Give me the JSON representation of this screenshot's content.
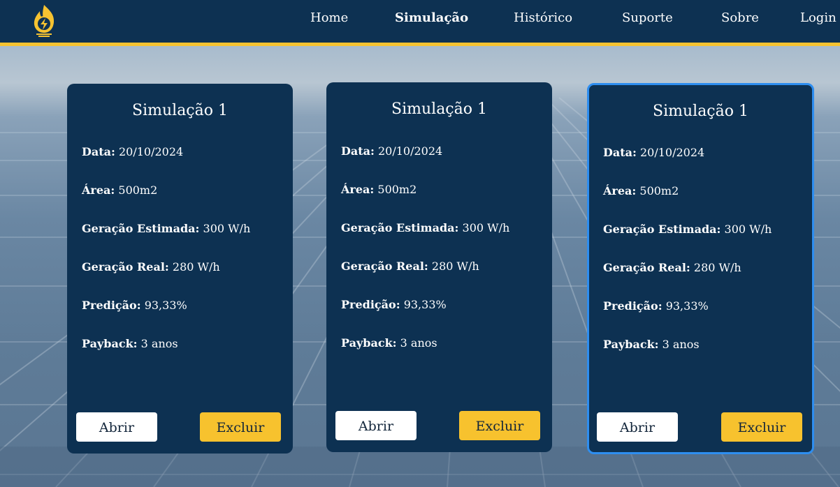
{
  "nav": {
    "items": [
      {
        "label": "Home",
        "active": false
      },
      {
        "label": "Simulação",
        "active": true
      },
      {
        "label": "Histórico",
        "active": false
      },
      {
        "label": "Suporte",
        "active": false
      },
      {
        "label": "Sobre",
        "active": false
      },
      {
        "label": "Login",
        "active": false
      }
    ]
  },
  "cards": [
    {
      "title": "Simulação 1",
      "fields": [
        {
          "label": "Data:",
          "value": "20/10/2024"
        },
        {
          "label": "Área:",
          "value": "500m2"
        },
        {
          "label": "Geração Estimada:",
          "value": "300 W/h"
        },
        {
          "label": "Geração Real:",
          "value": "280 W/h"
        },
        {
          "label": "Predição:",
          "value": "93,33%"
        },
        {
          "label": "Payback:",
          "value": "3 anos"
        }
      ],
      "open_label": "Abrir",
      "delete_label": "Excluir",
      "selected": false
    },
    {
      "title": "Simulação 1",
      "fields": [
        {
          "label": "Data:",
          "value": "20/10/2024"
        },
        {
          "label": "Área:",
          "value": "500m2"
        },
        {
          "label": "Geração Estimada:",
          "value": "300 W/h"
        },
        {
          "label": "Geração Real:",
          "value": "280 W/h"
        },
        {
          "label": "Predição:",
          "value": "93,33%"
        },
        {
          "label": "Payback:",
          "value": "3 anos"
        }
      ],
      "open_label": "Abrir",
      "delete_label": "Excluir",
      "selected": false
    },
    {
      "title": "Simulação 1",
      "fields": [
        {
          "label": "Data:",
          "value": "20/10/2024"
        },
        {
          "label": "Área:",
          "value": "500m2"
        },
        {
          "label": "Geração Estimada:",
          "value": "300 W/h"
        },
        {
          "label": "Geração Real:",
          "value": "280 W/h"
        },
        {
          "label": "Predição:",
          "value": "93,33%"
        },
        {
          "label": "Payback:",
          "value": "3 anos"
        }
      ],
      "open_label": "Abrir",
      "delete_label": "Excluir",
      "selected": true
    }
  ],
  "colors": {
    "navbar": "#0d3152",
    "accent": "#f6c331",
    "card": "#0d3152",
    "selected_border": "#2e8ef0",
    "delete_button": "#f7c22e",
    "open_button": "#ffffff"
  },
  "icons": {
    "logo": "solar-flame-bolt-logo"
  }
}
